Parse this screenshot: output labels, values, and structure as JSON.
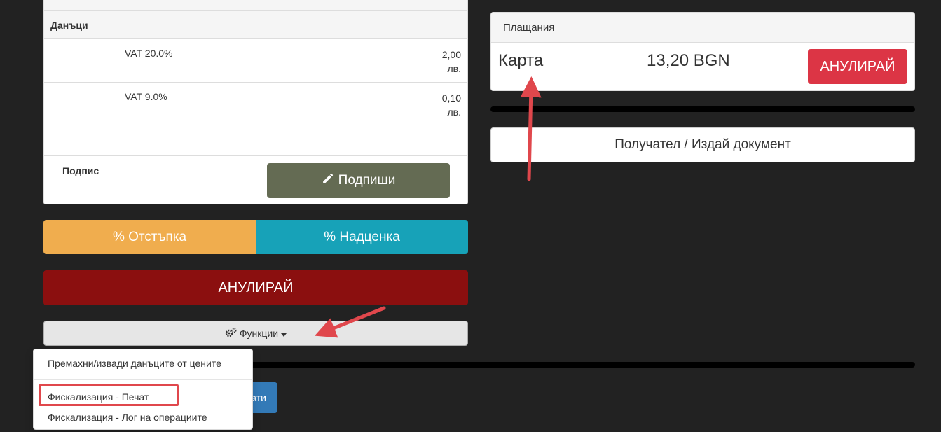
{
  "taxes": {
    "header": "Данъци",
    "rows": [
      {
        "name": "VAT 20.0%",
        "amount_line1": "2,00",
        "amount_line2": "лв."
      },
      {
        "name": "VAT 9.0%",
        "amount_line1": "0,10",
        "amount_line2": "лв."
      }
    ],
    "signature_label": "Подпис",
    "sign_button_label": "Подпиши"
  },
  "actions": {
    "discount_label": "% Отстъпка",
    "markup_label": "% Надценка",
    "cancel_label": "АНУЛИРАЙ",
    "functions_label": "Функции",
    "hidden_button_label": "ати"
  },
  "functions_menu": {
    "items": [
      "Премахни/извади данъците от цените",
      "Фискализация - Печат",
      "Фискализация - Лог на операциите"
    ]
  },
  "payments": {
    "title": "Плащания",
    "method": "Карта",
    "amount": "13,20 BGN",
    "cancel_label": "АНУЛИРАЙ"
  },
  "recipient": {
    "button_label": "Получател / Издай документ"
  },
  "colors": {
    "background": "#222222",
    "sign_button": "#646b53",
    "discount": "#f0ad4e",
    "markup": "#17a2b8",
    "cancel_main": "#8b0f0f",
    "cancel_payment": "#dc3545",
    "annotation": "#e0474c"
  },
  "icons": {
    "sign": "pencil-icon",
    "functions": "cogs-icon",
    "caret": "caret-down-icon"
  }
}
